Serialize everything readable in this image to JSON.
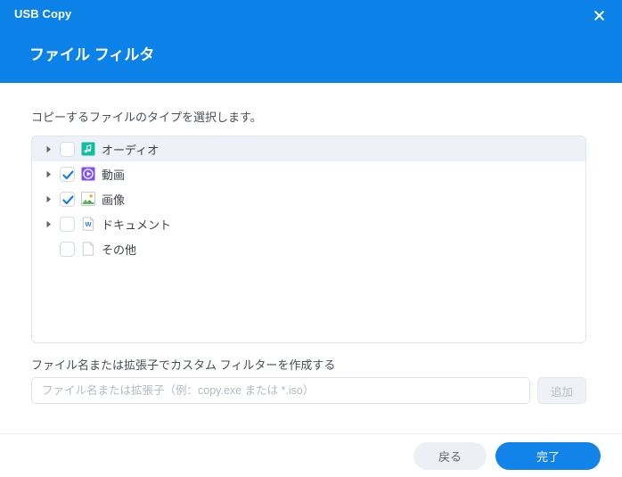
{
  "window": {
    "app_title": "USB Copy",
    "close_icon": "close-icon",
    "heading": "ファイル フィルタ",
    "header_color": "#0c81e8"
  },
  "main": {
    "instruction": "コピーするファイルのタイプを選択します。",
    "file_types": [
      {
        "label": "オーディオ",
        "checked": false,
        "expandable": true,
        "selected": true,
        "icon": "audio-music-note-icon",
        "icon_color": "#10bfa0"
      },
      {
        "label": "動画",
        "checked": true,
        "expandable": true,
        "selected": false,
        "icon": "video-play-circle-icon",
        "icon_color": "#7c4dff"
      },
      {
        "label": "画像",
        "checked": true,
        "expandable": true,
        "selected": false,
        "icon": "image-picture-icon",
        "icon_color": "#4caf50"
      },
      {
        "label": "ドキュメント",
        "checked": false,
        "expandable": true,
        "selected": false,
        "icon": "document-word-icon",
        "icon_color": "#2a7cd6"
      },
      {
        "label": "その他",
        "checked": false,
        "expandable": false,
        "selected": false,
        "icon": "blank-file-icon",
        "icon_color": "#c8ced6"
      }
    ],
    "custom_filter": {
      "label": "ファイル名または拡張子でカスタム フィルターを作成する",
      "input_value": "",
      "input_placeholder": "ファイル名または拡張子（例：copy.exe または *.iso）",
      "add_label": "追加",
      "add_disabled": true
    }
  },
  "footer": {
    "back_label": "戻る",
    "done_label": "完了",
    "primary_color": "#1283e8"
  }
}
